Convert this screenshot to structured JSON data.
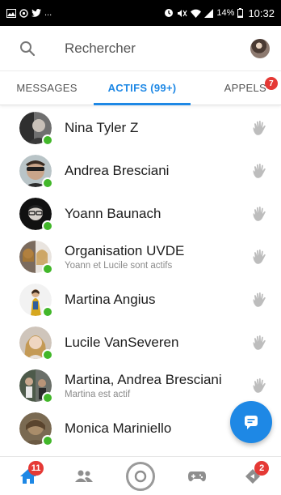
{
  "status_bar": {
    "left_icons": [
      "gallery-icon",
      "settings-icon",
      "twitter-icon"
    ],
    "left_ellipsis": "...",
    "right_icons": [
      "sync-icon",
      "mute-icon",
      "wifi-icon",
      "signal-icon"
    ],
    "battery": "14%",
    "time": "10:32"
  },
  "search": {
    "placeholder": "Rechercher",
    "icon": "search-icon"
  },
  "tabs": [
    {
      "label": "MESSAGES",
      "active": false
    },
    {
      "label": "ACTIFS (99+)",
      "active": true
    },
    {
      "label": "APPELS",
      "active": false,
      "badge": "7"
    }
  ],
  "contacts": [
    {
      "name": "Nina Tyler Z",
      "subtitle": "",
      "online": true
    },
    {
      "name": "Andrea Bresciani",
      "subtitle": "",
      "online": true
    },
    {
      "name": "Yoann Baunach",
      "subtitle": "",
      "online": true
    },
    {
      "name": "Organisation UVDE",
      "subtitle": "Yoann et Lucile sont actifs",
      "online": true
    },
    {
      "name": "Martina Angius",
      "subtitle": "",
      "online": true
    },
    {
      "name": "Lucile VanSeveren",
      "subtitle": "",
      "online": true
    },
    {
      "name": "Martina, Andrea Bresciani",
      "subtitle": "Martina est actif",
      "online": true
    },
    {
      "name": "Monica Mariniello",
      "subtitle": "",
      "online": true
    }
  ],
  "fab": {
    "icon": "compose-icon"
  },
  "bottom_nav": [
    {
      "icon": "home-icon",
      "badge": "11",
      "active": true
    },
    {
      "icon": "people-icon",
      "badge": ""
    },
    {
      "icon": "camera-icon",
      "badge": ""
    },
    {
      "icon": "games-icon",
      "badge": ""
    },
    {
      "icon": "discover-icon",
      "badge": "2"
    }
  ],
  "colors": {
    "accent": "#1e88e5",
    "online": "#42b72a",
    "badge": "#e53935",
    "status_bar": "#000000"
  }
}
